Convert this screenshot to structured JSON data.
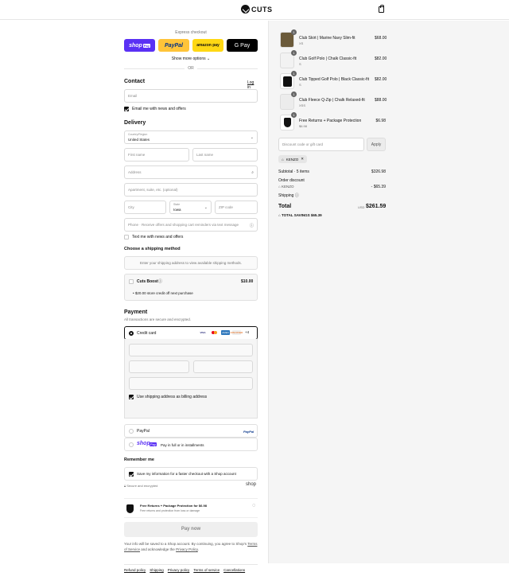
{
  "header": {
    "brand": "CUTS"
  },
  "express": {
    "label": "Express checkout",
    "shop_pay": "shop",
    "shop_pay_badge": "Pay",
    "paypal": "PayPal",
    "amazon_pay": "amazon pay",
    "google_pay": "G Pay",
    "show_more": "Show more options",
    "or": "OR"
  },
  "contact": {
    "heading": "Contact",
    "login": "Log in",
    "email_placeholder": "Email",
    "news_label": "Email me with news and offers",
    "news_checked": true
  },
  "delivery": {
    "heading": "Delivery",
    "country_label": "Country/Region",
    "country_value": "United States",
    "first_name": "First name",
    "last_name": "Last name",
    "address": "Address",
    "apartment": "Apartment, suite, etc. (optional)",
    "city": "City",
    "state_label": "State",
    "state_value": "Iowa",
    "zip": "ZIP code",
    "phone": "Phone · Receive offers and shopping cart reminders via text message",
    "text_label": "Text me with news and offers",
    "text_checked": false
  },
  "shipping": {
    "heading": "Choose a shipping method",
    "notice": "Enter your shipping address to view available shipping methods.",
    "boost_name": "Cuts Boost",
    "boost_price": "$10.00",
    "boost_bullet": "$20.00 store credit off next purchase"
  },
  "payment": {
    "heading": "Payment",
    "subtitle": "All transactions are secure and encrypted.",
    "credit_card": "Credit card",
    "card_logos": [
      "VISA",
      "MC",
      "AMEX",
      "DISCOVER"
    ],
    "more_cards": "+4",
    "billing_label": "Use shipping address as billing address",
    "paypal": "PayPal",
    "paypal_logo": "PayPal",
    "shoppay_logo": "shop",
    "shoppay_badge": "Pay",
    "shoppay_text": "Pay in full or in installments"
  },
  "remember": {
    "heading": "Remember me",
    "label": "Save my information for a faster checkout with a Shop account",
    "secure": "Secure and encrypted",
    "shop_logo": "shop"
  },
  "protection": {
    "title": "Free Returns + Package Protection for $6.98",
    "sub": "Free returns and protection from loss or damage"
  },
  "pay_now": "Pay now",
  "legal": {
    "text_1": "Your info will be saved to a Shop account. By continuing, you agree to Shop's",
    "terms": "Terms of Service",
    "text_2": "and acknowledge the",
    "privacy": "Privacy Policy",
    "end": "."
  },
  "footer_links": [
    "Refund policy",
    "Shipping",
    "Privacy policy",
    "Terms of service",
    "Cancellations"
  ],
  "summary": {
    "items": [
      {
        "qty": "1",
        "name": "Club Skirt | Marine Navy Slim-fit",
        "variant": "XS",
        "price": "$68.00"
      },
      {
        "qty": "1",
        "name": "Club Golf Polo | Chalk Classic-fit",
        "variant": "S",
        "price": "$82.00"
      },
      {
        "qty": "1",
        "name": "Club Tipped Golf Polo | Black Classic-fit",
        "variant": "S",
        "price": "$82.00"
      },
      {
        "qty": "1",
        "name": "Club Fleece Q-Zip | Chalk Relaxed-fit",
        "variant": "XSS",
        "price": "$88.00"
      },
      {
        "qty": "1",
        "name": "Free Returns + Package Protection",
        "variant": "$6.98",
        "price": "$6.98"
      }
    ],
    "discount_placeholder": "Discount code or gift card",
    "apply": "Apply",
    "code_tag": "KENZO",
    "subtotal_label": "Subtotal · 5 items",
    "subtotal": "$326.98",
    "order_discount": "Order discount",
    "discount_code": "KENZO",
    "discount_amount": "- $65.39",
    "shipping_label": "Shipping",
    "total_label": "Total",
    "currency": "USD",
    "total": "$261.59",
    "savings_label": "TOTAL SAVINGS",
    "savings": "$65.39"
  }
}
